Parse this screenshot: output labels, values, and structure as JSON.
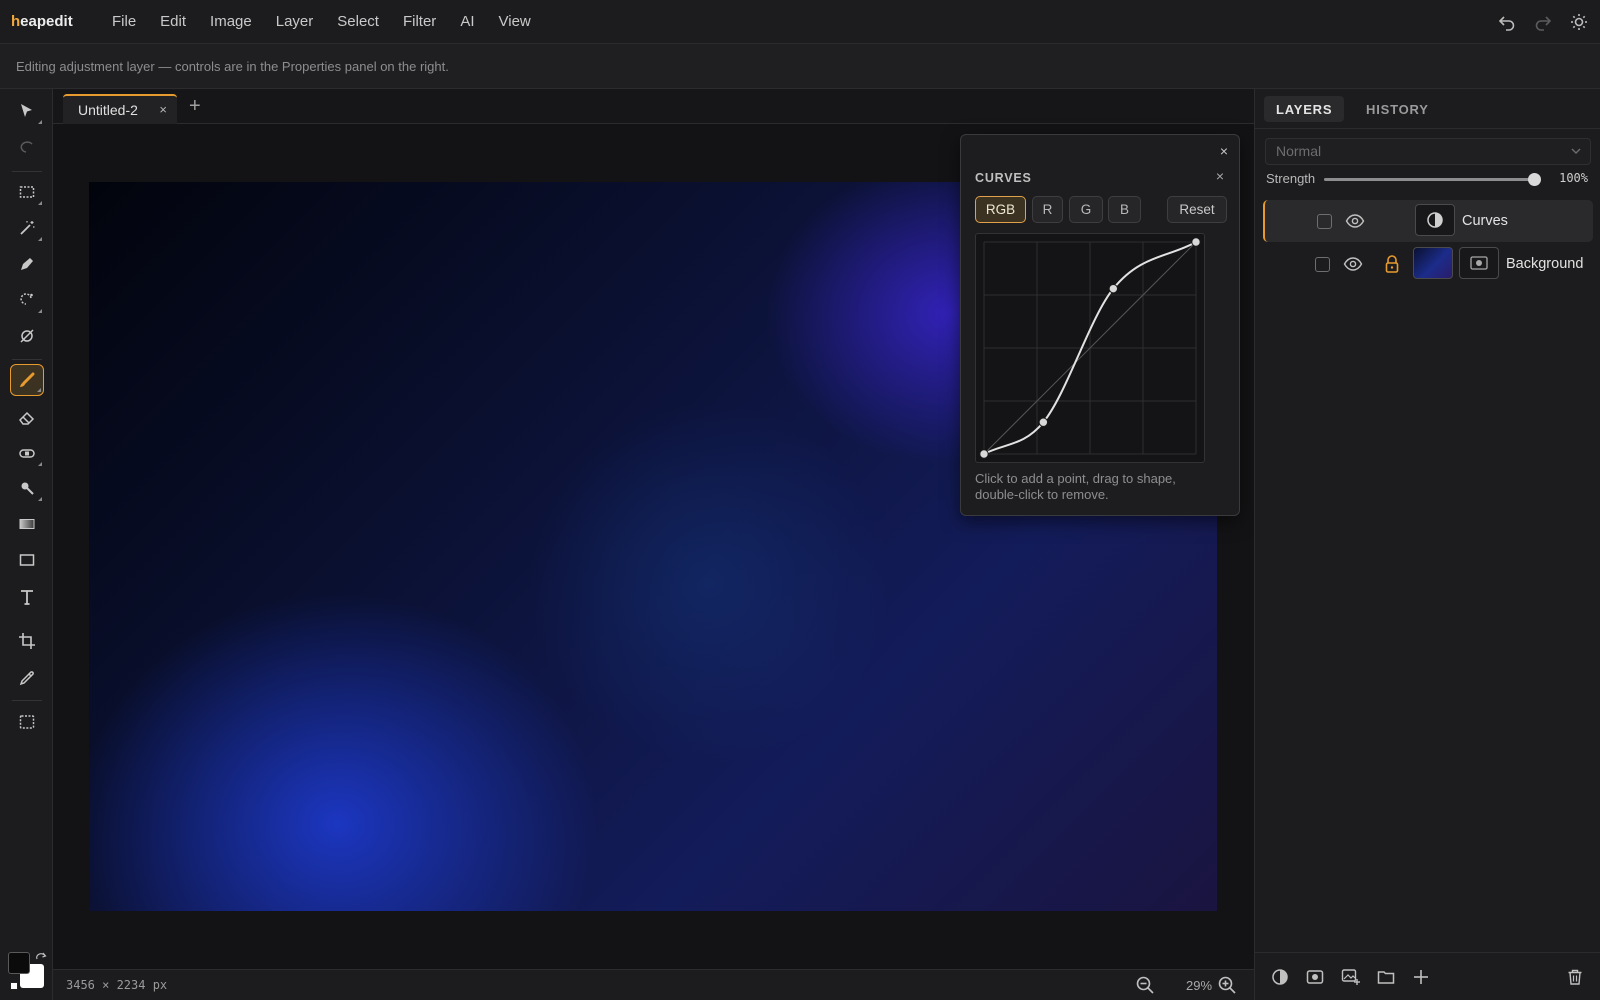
{
  "app": {
    "logo_first": "h",
    "logo_rest": "eapedit",
    "menu": [
      "File",
      "Edit",
      "Image",
      "Layer",
      "Select",
      "Filter",
      "AI",
      "View"
    ],
    "right_icons": [
      "undo-icon",
      "redo-icon",
      "settings-sun-icon"
    ]
  },
  "infobar": {
    "text": "Editing adjustment layer — controls are in the Properties panel on the right."
  },
  "toolbar": {
    "tools": [
      "move-tool-icon",
      "lasso-tool-icon",
      "marquee-tool-icon",
      "magic-wand-icon",
      "pen-tool-icon",
      "quick-select-icon",
      "healing-tool-icon",
      "brush-tool-icon",
      "eraser-tool-icon",
      "bandage-tool-icon",
      "smudge-tool-icon",
      "gradient-tool-icon",
      "rectangle-tool-icon",
      "text-tool-icon",
      "crop-tool-icon",
      "eyedropper-icon",
      "frame-tool-icon"
    ],
    "active_tool": "brush-tool-icon",
    "foreground_color": "#0b0b0b",
    "background_color": "#ffffff"
  },
  "document": {
    "tab_title": "Untitled-2",
    "tab_close": "×",
    "tab_add": "+",
    "dimensions": "3456 × 2234 px",
    "zoom": "29%"
  },
  "curves": {
    "outer_close": "×",
    "title": "CURVES",
    "inner_close": "×",
    "channels": [
      "RGB",
      "R",
      "G",
      "B"
    ],
    "active_channel": "RGB",
    "reset_label": "Reset",
    "points": [
      [
        0,
        0
      ],
      [
        0.28,
        0.15
      ],
      [
        0.61,
        0.78
      ],
      [
        1,
        1
      ]
    ],
    "hint": "Click to add a point, drag to shape, double-click to remove."
  },
  "panel": {
    "tabs": [
      "LAYERS",
      "HISTORY"
    ],
    "active_tab": "LAYERS",
    "blend_mode": "Normal",
    "strength_label": "Strength",
    "strength_value": "100%",
    "strength_fraction": 1.0,
    "layers": [
      {
        "name": "Curves",
        "selected": true,
        "locked": false,
        "type": "adjustment"
      },
      {
        "name": "Background",
        "selected": false,
        "locked": true,
        "type": "image"
      }
    ],
    "footer_icons": [
      "adjustment-layer-icon",
      "mask-icon",
      "add-image-icon",
      "folder-icon",
      "add-layer-icon",
      "trash-icon"
    ]
  },
  "colors": {
    "accent": "#e79b2e",
    "bg": "#1c1c1e"
  }
}
